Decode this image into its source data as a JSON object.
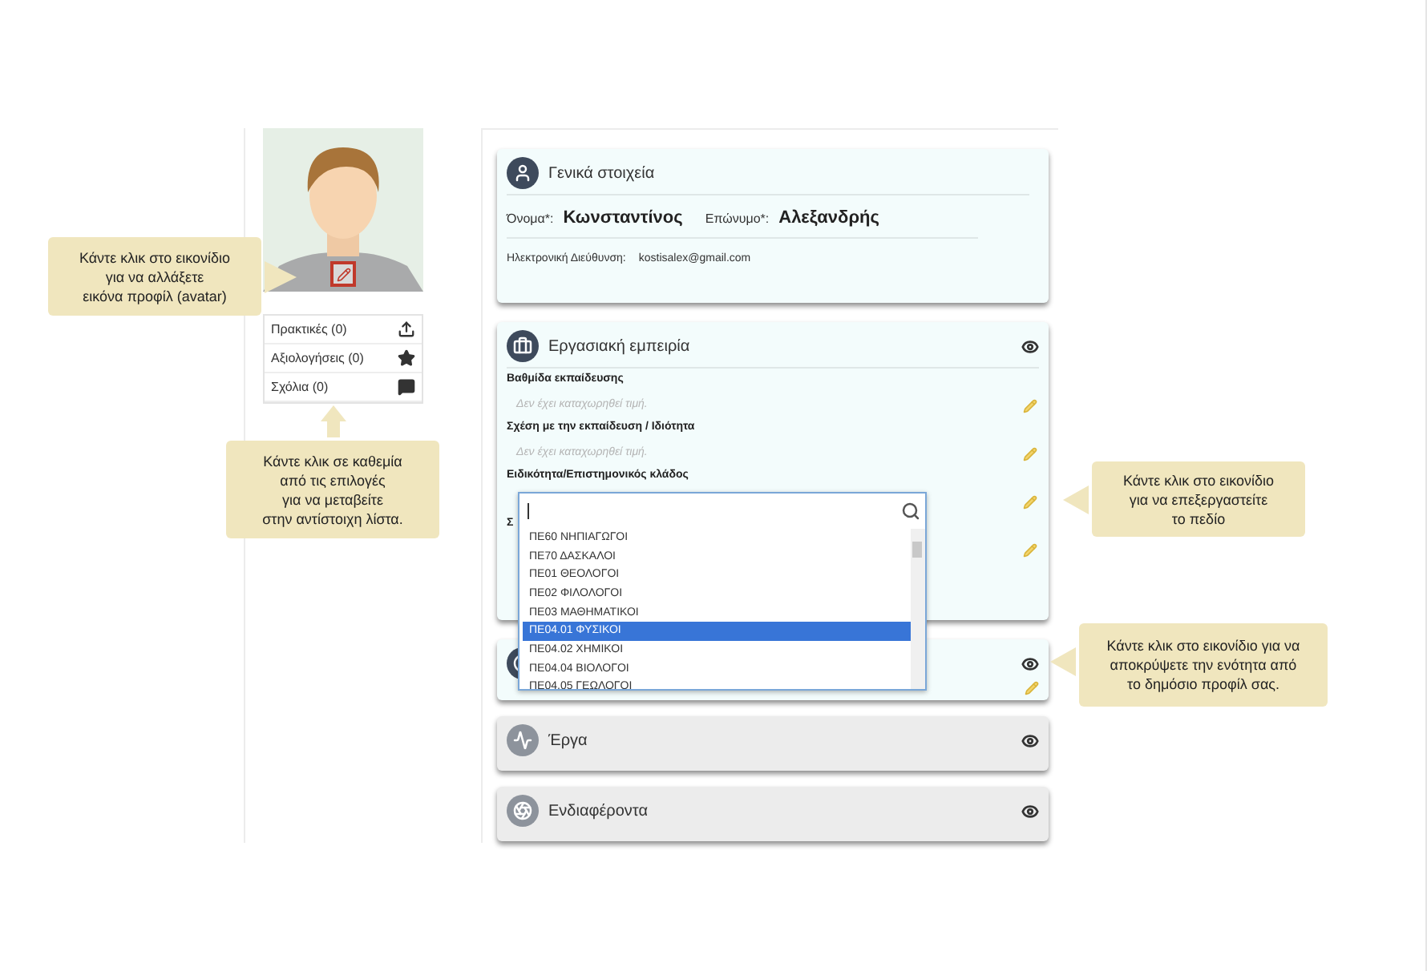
{
  "profile_menu": [
    {
      "label": "Πρακτικές (0)",
      "kind": "upload"
    },
    {
      "label": "Αξιολογήσεις (0)",
      "kind": "star"
    },
    {
      "label": "Σχόλια (0)",
      "kind": "comment"
    }
  ],
  "cards": [
    {
      "kind": "general",
      "expanded": true,
      "title": "Γενικά στοιχεία",
      "first_name_label": "Όνομα*:",
      "first_name": "Κωνσταντίνος",
      "last_name_label": "Επώνυμο*:",
      "last_name": "Αλεξανδρής",
      "email_label": "Ηλεκτρονική Διεύθυνση:",
      "email": "kostisalex@gmail.com"
    },
    {
      "kind": "fields",
      "expanded": true,
      "title": "Εργασιακή εμπειρία",
      "fields": [
        {
          "label": "Βαθμίδα εκπαίδευσης",
          "value": "Δεν έχει καταχωρηθεί τιμή."
        },
        {
          "label": "Σχέση με την εκπαίδευση / Ιδιότητα",
          "value": "Δεν έχει καταχωρηθεί τιμή."
        },
        {
          "label": "Ειδικότητα/Επιστημονικός κλάδος"
        },
        {
          "label": "Σ"
        }
      ]
    },
    {
      "kind": "hidden_title",
      "expanded": true
    },
    {
      "kind": "header",
      "expanded": false,
      "title": "Έργα"
    },
    {
      "kind": "header",
      "expanded": false,
      "title": "Ενδιαφέροντα"
    }
  ],
  "dropdown": {
    "options": [
      {
        "label": "ΠΕ60 ΝΗΠΙΑΓΩΓΟΙ",
        "selected": false
      },
      {
        "label": "ΠΕ70 ΔΑΣΚΑΛΟΙ",
        "selected": false
      },
      {
        "label": "ΠΕ01 ΘΕΟΛΟΓΟΙ",
        "selected": false
      },
      {
        "label": "ΠΕ02 ΦΙΛΟΛΟΓΟΙ",
        "selected": false
      },
      {
        "label": "ΠΕ03 ΜΑΘΗΜΑΤΙΚΟΙ",
        "selected": false
      },
      {
        "label": "ΠΕ04.01 ΦΥΣΙΚΟΙ",
        "selected": true
      },
      {
        "label": "ΠΕ04.02 ΧΗΜΙΚΟΙ",
        "selected": false
      },
      {
        "label": "ΠΕ04.04 ΒΙΟΛΟΓΟΙ",
        "selected": false
      },
      {
        "label": "ΠΕ04.05 ΓΕΩΛΟΓΟΙ",
        "selected": false
      }
    ]
  },
  "callouts": [
    {
      "lines": [
        "Κάντε κλικ στο εικονίδιο",
        "για να αλλάξετε",
        "εικόνα προφίλ (avatar)"
      ]
    },
    {
      "lines": [
        "Κάντε κλικ σε καθεμία",
        "από τις επιλογές",
        "για να μεταβείτε",
        "στην αντίστοιχη λίστα."
      ]
    },
    {
      "lines": [
        "Κάντε κλικ στο εικονίδιο",
        "για να επεξεργαστείτε",
        "το πεδίο"
      ]
    },
    {
      "lines": [
        "Κάντε κλικ στο εικονίδιο για να",
        "αποκρύψετε την ενότητα από",
        "το δημόσιο προφίλ σας."
      ]
    }
  ]
}
